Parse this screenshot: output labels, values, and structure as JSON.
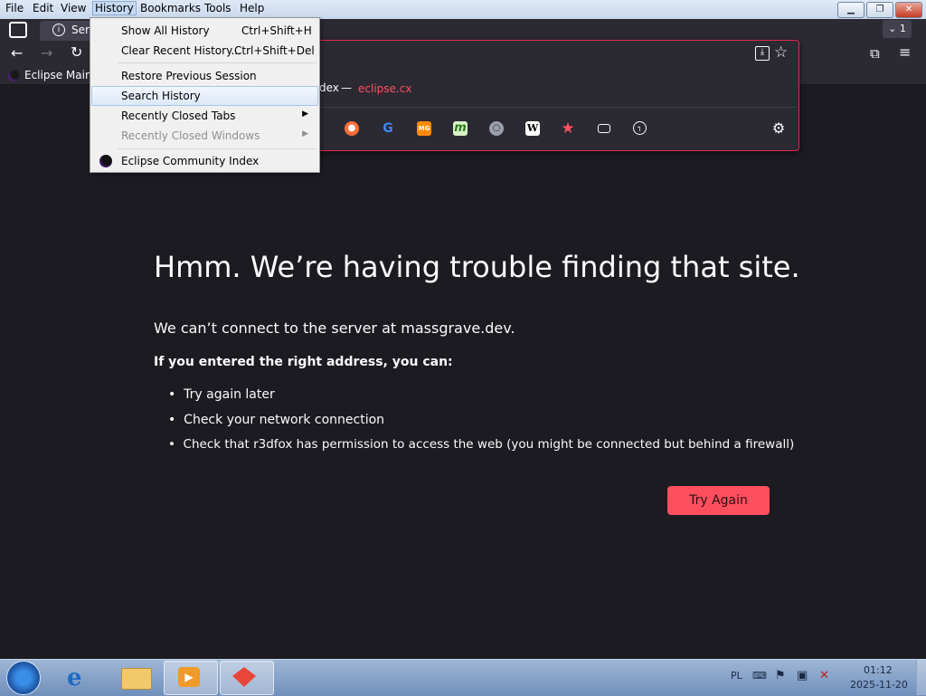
{
  "menubar": {
    "file": "File",
    "edit": "Edit",
    "view": "View",
    "history": "History",
    "bookmarks": "Bookmarks",
    "tools": "Tools",
    "help": "Help"
  },
  "tab": {
    "title": "Serv",
    "count": "1"
  },
  "bookmarks_bar": {
    "item1": "Eclipse Main S"
  },
  "urlbar_popup": {
    "title_fragment": "dex",
    "separator": "—",
    "domain": "eclipse.cx",
    "domain_color": "#ff4f5e"
  },
  "history_menu": {
    "items": [
      {
        "label": "Show All History",
        "shortcut": "Ctrl+Shift+H"
      },
      {
        "label": "Clear Recent History...",
        "shortcut": "Ctrl+Shift+Del"
      },
      {
        "label": "Restore Previous Session"
      },
      {
        "label": "Search History"
      },
      {
        "label": "Recently Closed Tabs"
      },
      {
        "label": "Recently Closed Windows"
      },
      {
        "label": "Eclipse Community Index"
      }
    ]
  },
  "error_page": {
    "title": "Hmm. We’re having trouble finding that site.",
    "message": "We can’t connect to the server at massgrave.dev.",
    "subtitle": "If you entered the right address, you can:",
    "bullets": [
      "Try again later",
      "Check your network connection",
      "Check that r3dfox has permission to access the web (you might be connected but behind a firewall)"
    ],
    "button": "Try Again"
  },
  "taskbar": {
    "lang": "PL",
    "time": "01:12",
    "date": "2025-11-20"
  },
  "colors": {
    "accent": "#ff4f5e",
    "page_bg": "#1c1b22",
    "chrome_bg": "#2b2a33"
  }
}
